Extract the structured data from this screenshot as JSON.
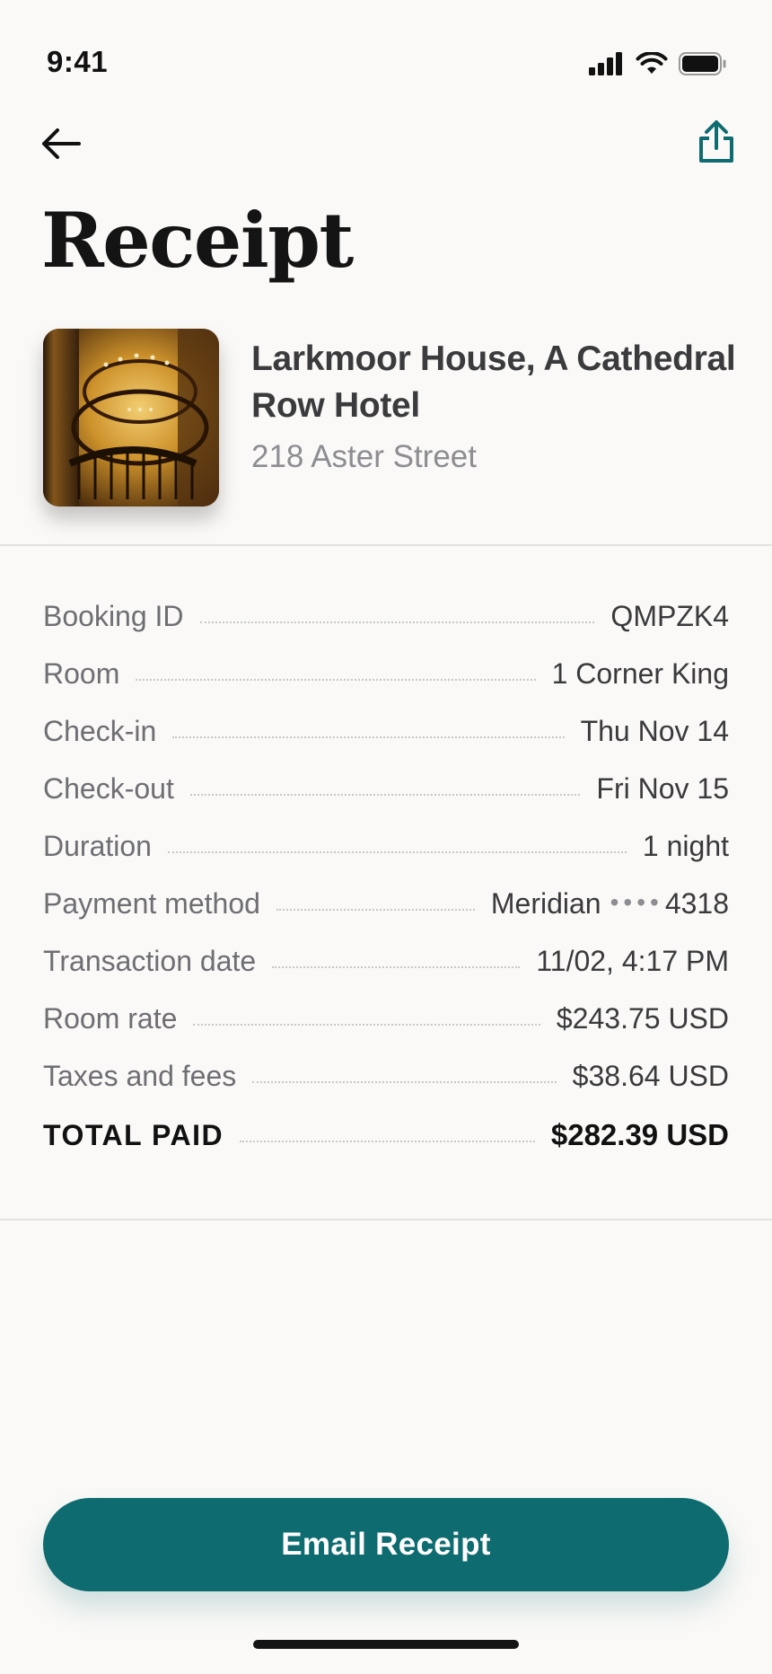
{
  "status_bar": {
    "time": "9:41"
  },
  "nav": {
    "back_icon": "arrow-left-icon",
    "share_icon": "share-icon"
  },
  "page": {
    "title": "Receipt"
  },
  "hotel": {
    "name": "Larkmoor House, A Cathedral Row Hotel",
    "address": "218 Aster Street",
    "image": "spiral-staircase-photo"
  },
  "details": {
    "rows": [
      {
        "label": "Booking ID",
        "value": "QMPZK4"
      },
      {
        "label": "Room",
        "value": "1 Corner King"
      },
      {
        "label": "Check-in",
        "value": "Thu Nov 14"
      },
      {
        "label": "Check-out",
        "value": "Fri Nov 15"
      },
      {
        "label": "Duration",
        "value": "1 night"
      },
      {
        "label": "Payment method",
        "value_prefix": "Meridian",
        "value_mask": "••••",
        "value_suffix": "4318"
      },
      {
        "label": "Transaction date",
        "value": "11/02, 4:17 PM"
      },
      {
        "label": "Room rate",
        "value": "$243.75 USD"
      },
      {
        "label": "Taxes and fees",
        "value": "$38.64 USD"
      }
    ],
    "total": {
      "label": "TOTAL PAID",
      "value": "$282.39 USD"
    }
  },
  "actions": {
    "email_label": "Email Receipt"
  },
  "colors": {
    "accent": "#0e6b6f",
    "background": "#faf9f7"
  }
}
